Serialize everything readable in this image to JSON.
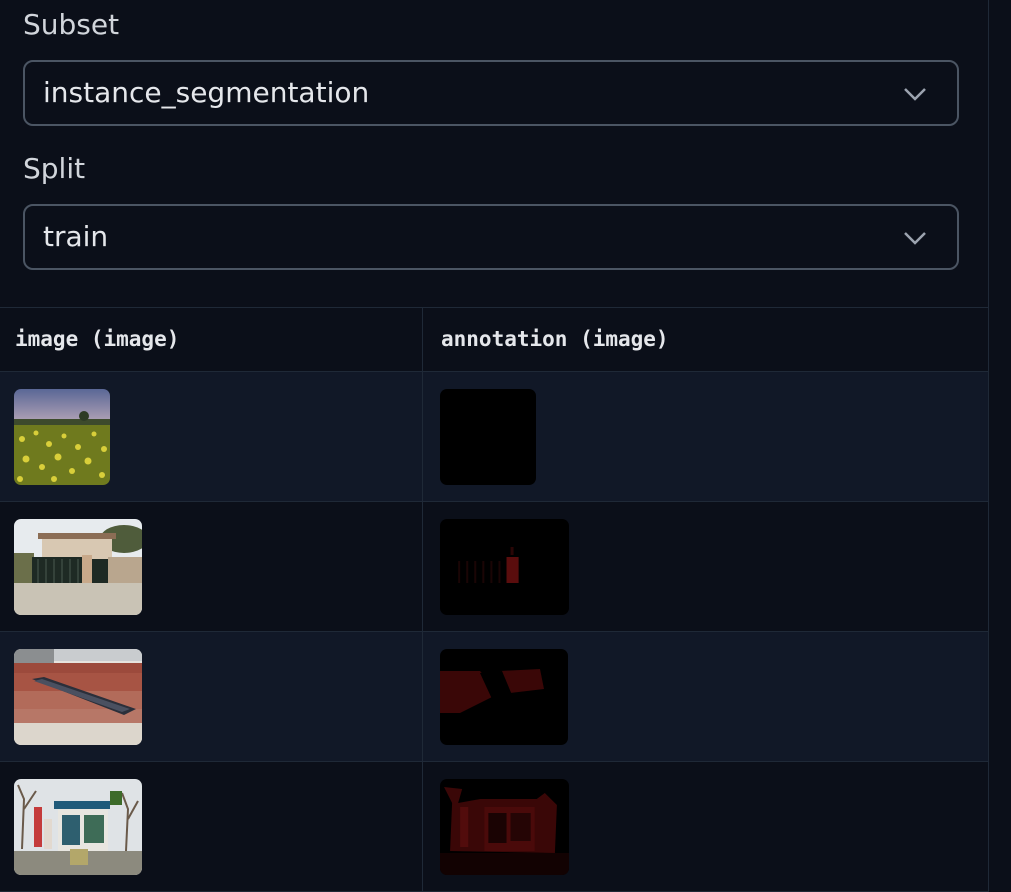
{
  "subset": {
    "label": "Subset",
    "value": "instance_segmentation"
  },
  "split": {
    "label": "Split",
    "value": "train"
  },
  "table": {
    "columns": [
      "image (image)",
      "annotation (image)"
    ],
    "rows": [
      {
        "image": "field-flowers",
        "annotation": "mask-black"
      },
      {
        "image": "gate-house",
        "annotation": "mask-gate"
      },
      {
        "image": "ramp-steps",
        "annotation": "mask-ramp"
      },
      {
        "image": "kiosk-street",
        "annotation": "mask-kiosk"
      }
    ]
  },
  "icons": {
    "dropdown": "chevron-down-icon"
  },
  "colors": {
    "background": "#0b0f19",
    "row_alt": "#111827",
    "border": "#4b5563"
  }
}
